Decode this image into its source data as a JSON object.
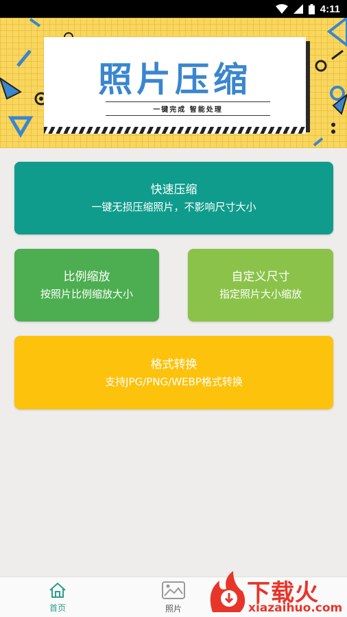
{
  "status_bar": {
    "time": "4:11",
    "icons": [
      "wifi-icon",
      "cell-signal-icon",
      "battery-icon"
    ]
  },
  "banner": {
    "title": "照片压缩",
    "subtitle": "一键完成  智能处理"
  },
  "features": {
    "quick": {
      "title": "快速压缩",
      "desc": "一键无损压缩照片，不影响尺寸大小",
      "color": "#109c8c"
    },
    "ratio": {
      "title": "比例缩放",
      "desc": "按照片比例缩放大小",
      "color": "#4cae50"
    },
    "custom": {
      "title": "自定义尺寸",
      "desc": "指定照片大小缩放",
      "color": "#8bc34a"
    },
    "format": {
      "title": "格式转换",
      "desc": "支持JPG/PNG/WEBP格式转换",
      "color": "#fdc20c"
    }
  },
  "tabbar": {
    "tabs": [
      {
        "label": "首页",
        "icon": "home-icon",
        "active": true
      },
      {
        "label": "照片",
        "icon": "photo-icon",
        "active": false
      }
    ]
  },
  "watermark": {
    "text": "下载火",
    "url": "xiazaihuo.com"
  },
  "colors": {
    "accent": "#2a9d8f",
    "banner_bg": "#f8d65f",
    "title_blue": "#3a86cf"
  }
}
